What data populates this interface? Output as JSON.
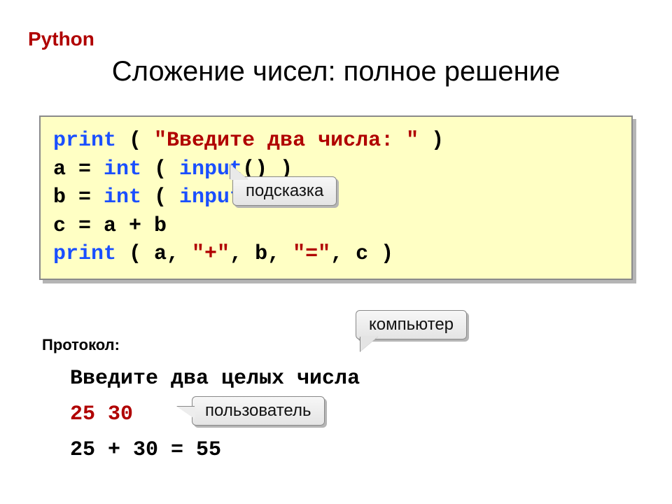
{
  "lang_label": "Python",
  "title": "Сложение чисел: полное решение",
  "code": {
    "l1": {
      "kw1": "print",
      "plain1": " ( ",
      "str": "\"Введите два числа: \"",
      "plain2": " )"
    },
    "l2": {
      "plain1": "a = ",
      "kw1": "int",
      "plain2": " ( ",
      "kw2": "input",
      "plain3": "() )"
    },
    "l3": {
      "plain1": "b = ",
      "kw1": "int",
      "plain2": " ( ",
      "kw2": "input",
      "plain3": "() )"
    },
    "l4": {
      "plain1": "c = a + b"
    },
    "l5": {
      "kw1": "print",
      "plain1": " ( a, ",
      "str1": "\"+\"",
      "plain2": ", b, ",
      "str2": "\"=\"",
      "plain3": ", c )"
    }
  },
  "callouts": {
    "hint": "подсказка",
    "computer": "компьютер",
    "user": "пользователь"
  },
  "protocol_label": "Протокол:",
  "protocol": {
    "line1": "Введите два целых числа",
    "line2": "25 30",
    "line3": "25 + 30 = 55"
  }
}
